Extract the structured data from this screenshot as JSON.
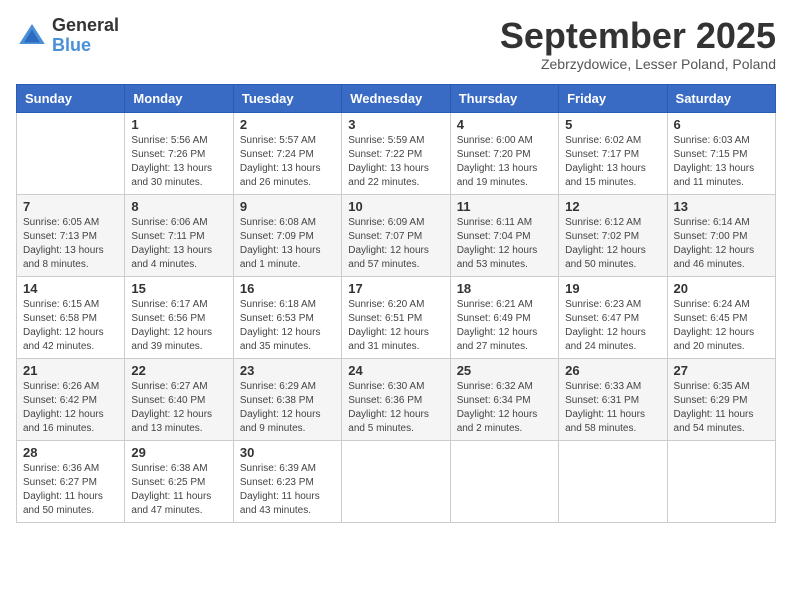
{
  "logo": {
    "general": "General",
    "blue": "Blue"
  },
  "title": "September 2025",
  "subtitle": "Zebrzydowice, Lesser Poland, Poland",
  "days_of_week": [
    "Sunday",
    "Monday",
    "Tuesday",
    "Wednesday",
    "Thursday",
    "Friday",
    "Saturday"
  ],
  "weeks": [
    [
      {
        "day": "",
        "info": ""
      },
      {
        "day": "1",
        "info": "Sunrise: 5:56 AM\nSunset: 7:26 PM\nDaylight: 13 hours\nand 30 minutes."
      },
      {
        "day": "2",
        "info": "Sunrise: 5:57 AM\nSunset: 7:24 PM\nDaylight: 13 hours\nand 26 minutes."
      },
      {
        "day": "3",
        "info": "Sunrise: 5:59 AM\nSunset: 7:22 PM\nDaylight: 13 hours\nand 22 minutes."
      },
      {
        "day": "4",
        "info": "Sunrise: 6:00 AM\nSunset: 7:20 PM\nDaylight: 13 hours\nand 19 minutes."
      },
      {
        "day": "5",
        "info": "Sunrise: 6:02 AM\nSunset: 7:17 PM\nDaylight: 13 hours\nand 15 minutes."
      },
      {
        "day": "6",
        "info": "Sunrise: 6:03 AM\nSunset: 7:15 PM\nDaylight: 13 hours\nand 11 minutes."
      }
    ],
    [
      {
        "day": "7",
        "info": "Sunrise: 6:05 AM\nSunset: 7:13 PM\nDaylight: 13 hours\nand 8 minutes."
      },
      {
        "day": "8",
        "info": "Sunrise: 6:06 AM\nSunset: 7:11 PM\nDaylight: 13 hours\nand 4 minutes."
      },
      {
        "day": "9",
        "info": "Sunrise: 6:08 AM\nSunset: 7:09 PM\nDaylight: 13 hours\nand 1 minute."
      },
      {
        "day": "10",
        "info": "Sunrise: 6:09 AM\nSunset: 7:07 PM\nDaylight: 12 hours\nand 57 minutes."
      },
      {
        "day": "11",
        "info": "Sunrise: 6:11 AM\nSunset: 7:04 PM\nDaylight: 12 hours\nand 53 minutes."
      },
      {
        "day": "12",
        "info": "Sunrise: 6:12 AM\nSunset: 7:02 PM\nDaylight: 12 hours\nand 50 minutes."
      },
      {
        "day": "13",
        "info": "Sunrise: 6:14 AM\nSunset: 7:00 PM\nDaylight: 12 hours\nand 46 minutes."
      }
    ],
    [
      {
        "day": "14",
        "info": "Sunrise: 6:15 AM\nSunset: 6:58 PM\nDaylight: 12 hours\nand 42 minutes."
      },
      {
        "day": "15",
        "info": "Sunrise: 6:17 AM\nSunset: 6:56 PM\nDaylight: 12 hours\nand 39 minutes."
      },
      {
        "day": "16",
        "info": "Sunrise: 6:18 AM\nSunset: 6:53 PM\nDaylight: 12 hours\nand 35 minutes."
      },
      {
        "day": "17",
        "info": "Sunrise: 6:20 AM\nSunset: 6:51 PM\nDaylight: 12 hours\nand 31 minutes."
      },
      {
        "day": "18",
        "info": "Sunrise: 6:21 AM\nSunset: 6:49 PM\nDaylight: 12 hours\nand 27 minutes."
      },
      {
        "day": "19",
        "info": "Sunrise: 6:23 AM\nSunset: 6:47 PM\nDaylight: 12 hours\nand 24 minutes."
      },
      {
        "day": "20",
        "info": "Sunrise: 6:24 AM\nSunset: 6:45 PM\nDaylight: 12 hours\nand 20 minutes."
      }
    ],
    [
      {
        "day": "21",
        "info": "Sunrise: 6:26 AM\nSunset: 6:42 PM\nDaylight: 12 hours\nand 16 minutes."
      },
      {
        "day": "22",
        "info": "Sunrise: 6:27 AM\nSunset: 6:40 PM\nDaylight: 12 hours\nand 13 minutes."
      },
      {
        "day": "23",
        "info": "Sunrise: 6:29 AM\nSunset: 6:38 PM\nDaylight: 12 hours\nand 9 minutes."
      },
      {
        "day": "24",
        "info": "Sunrise: 6:30 AM\nSunset: 6:36 PM\nDaylight: 12 hours\nand 5 minutes."
      },
      {
        "day": "25",
        "info": "Sunrise: 6:32 AM\nSunset: 6:34 PM\nDaylight: 12 hours\nand 2 minutes."
      },
      {
        "day": "26",
        "info": "Sunrise: 6:33 AM\nSunset: 6:31 PM\nDaylight: 11 hours\nand 58 minutes."
      },
      {
        "day": "27",
        "info": "Sunrise: 6:35 AM\nSunset: 6:29 PM\nDaylight: 11 hours\nand 54 minutes."
      }
    ],
    [
      {
        "day": "28",
        "info": "Sunrise: 6:36 AM\nSunset: 6:27 PM\nDaylight: 11 hours\nand 50 minutes."
      },
      {
        "day": "29",
        "info": "Sunrise: 6:38 AM\nSunset: 6:25 PM\nDaylight: 11 hours\nand 47 minutes."
      },
      {
        "day": "30",
        "info": "Sunrise: 6:39 AM\nSunset: 6:23 PM\nDaylight: 11 hours\nand 43 minutes."
      },
      {
        "day": "",
        "info": ""
      },
      {
        "day": "",
        "info": ""
      },
      {
        "day": "",
        "info": ""
      },
      {
        "day": "",
        "info": ""
      }
    ]
  ]
}
